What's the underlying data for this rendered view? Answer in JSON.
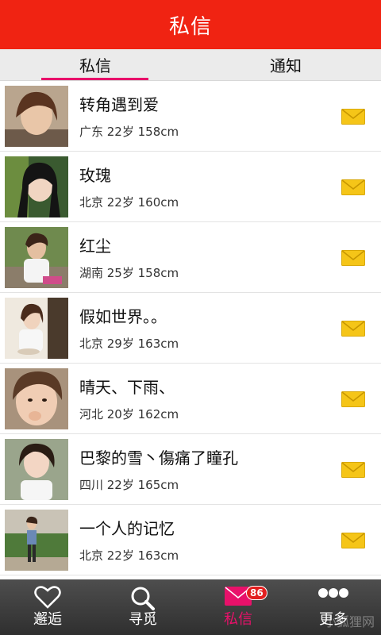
{
  "header": {
    "title": "私信"
  },
  "tabs": [
    {
      "label": "私信",
      "active": true
    },
    {
      "label": "通知",
      "active": false
    }
  ],
  "messages": [
    {
      "name": "转角遇到爱",
      "info": "广东 22岁 158cm"
    },
    {
      "name": "玫瑰",
      "info": "北京 22岁 160cm"
    },
    {
      "name": "红尘",
      "info": "湖南 25岁 158cm"
    },
    {
      "name": "假如世界。。",
      "info": "北京 29岁 163cm"
    },
    {
      "name": "晴天、下雨、",
      "info": "河北 20岁 162cm"
    },
    {
      "name": "巴黎的雪丶傷痛了瞳孔",
      "info": "四川 22岁 165cm"
    },
    {
      "name": "一个人的记忆",
      "info": "北京 22岁 163cm"
    }
  ],
  "bottom_nav": [
    {
      "label": "邂逅",
      "icon": "heart-icon"
    },
    {
      "label": "寻觅",
      "icon": "search-icon"
    },
    {
      "label": "私信",
      "icon": "mail-icon",
      "badge": "86",
      "active": true
    },
    {
      "label": "更多",
      "icon": "more-icon"
    }
  ],
  "watermark": "小狐狸网",
  "colors": {
    "header": "#f02312",
    "accent": "#e8116a",
    "mail_icon": "#f5c518"
  }
}
